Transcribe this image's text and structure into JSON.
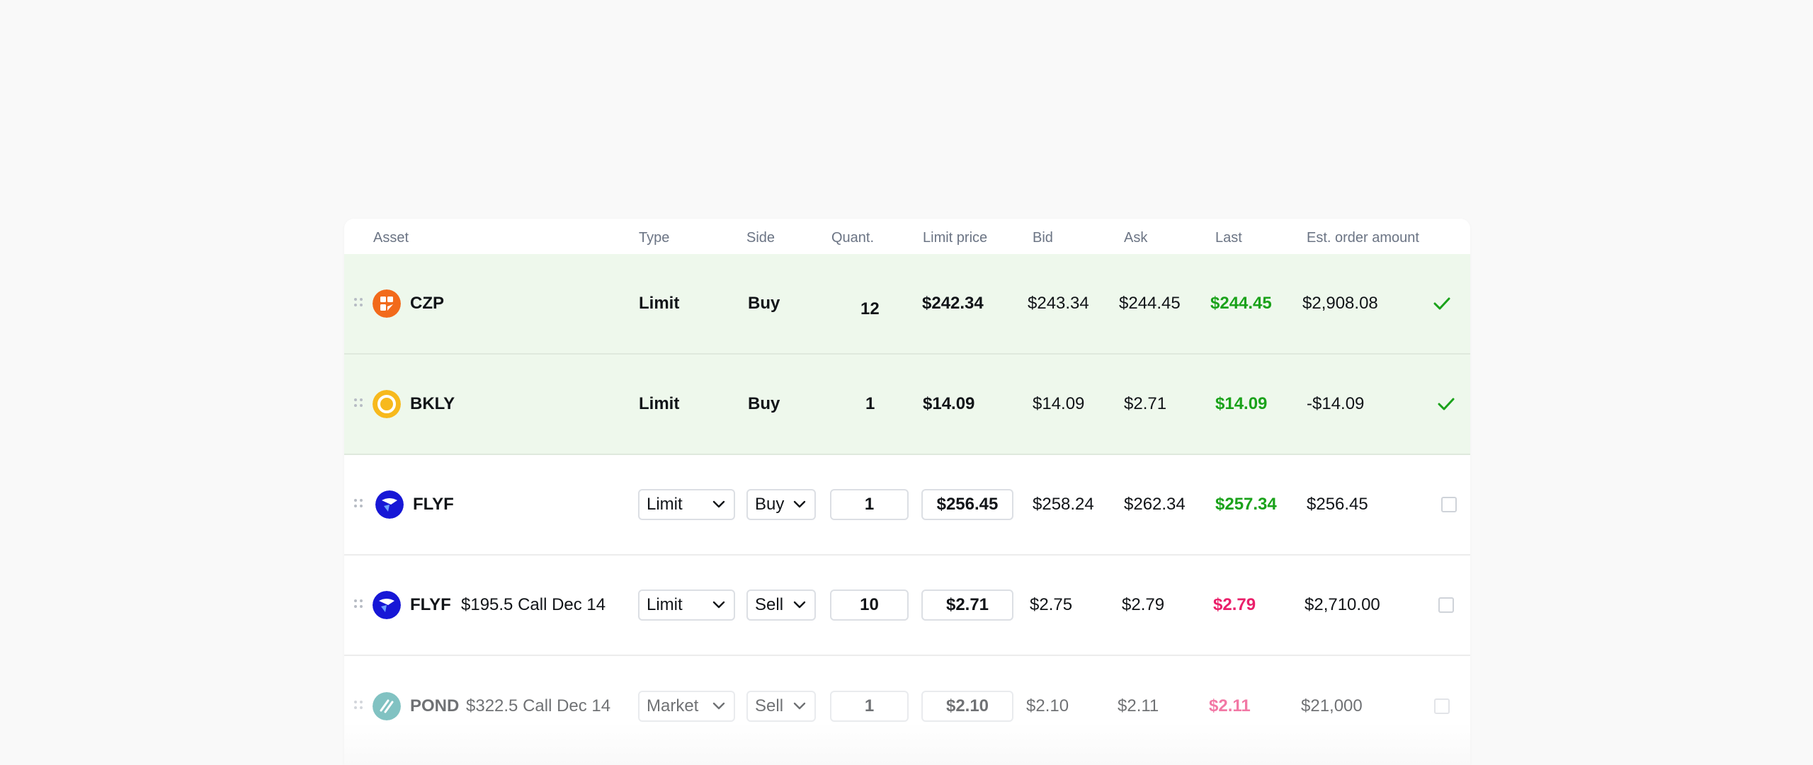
{
  "columns": {
    "asset": "Asset",
    "type": "Type",
    "side": "Side",
    "quant": "Quant.",
    "limit_price": "Limit price",
    "bid": "Bid",
    "ask": "Ask",
    "last": "Last",
    "est": "Est. order amount"
  },
  "rows": [
    {
      "ticker": "CZP",
      "contract": "",
      "type": "Limit",
      "side": "Buy",
      "quantity": "12",
      "limit_price": "$242.34",
      "bid": "$243.34",
      "ask": "$244.45",
      "last": "$244.45",
      "last_direction": "up",
      "est": "$2,908.08",
      "status": "confirmed",
      "logo_icon": "czp-logo-icon",
      "logo_color": "#f26a1b"
    },
    {
      "ticker": "BKLY",
      "contract": "",
      "type": "Limit",
      "side": "Buy",
      "quantity": "1",
      "limit_price": "$14.09",
      "bid": "$14.09",
      "ask": "$2.71",
      "last": "$14.09",
      "last_direction": "up",
      "est": "-$14.09",
      "status": "confirmed",
      "logo_icon": "bkly-logo-icon",
      "logo_color": "#f7b91d"
    },
    {
      "ticker": "FLYF",
      "contract": "",
      "type": "Limit",
      "side": "Buy",
      "quantity": "1",
      "limit_price": "$256.45",
      "bid": "$258.24",
      "ask": "$262.34",
      "last": "$257.34",
      "last_direction": "up",
      "est": "$256.45",
      "status": "editable",
      "logo_icon": "flyf-logo-icon",
      "logo_color": "#1717d6"
    },
    {
      "ticker": "FLYF",
      "contract": "$195.5 Call Dec 14",
      "type": "Limit",
      "side": "Sell",
      "quantity": "10",
      "limit_price": "$2.71",
      "bid": "$2.75",
      "ask": "$2.79",
      "last": "$2.79",
      "last_direction": "down",
      "est": "$2,710.00",
      "status": "editable",
      "logo_icon": "flyf-logo-icon",
      "logo_color": "#1717d6"
    },
    {
      "ticker": "POND",
      "contract": "$322.5 Call Dec 14",
      "type": "Market",
      "side": "Sell",
      "quantity": "1",
      "limit_price": "$2.10",
      "bid": "$2.10",
      "ask": "$2.11",
      "last": "$2.11",
      "last_direction": "down",
      "est": "$21,000",
      "status": "editable",
      "logo_icon": "pond-logo-icon",
      "logo_color": "#2f9a9a"
    }
  ],
  "colors": {
    "up": "#1aa21a",
    "down": "#ea1f6a",
    "filled_row": "#eef8ec"
  }
}
